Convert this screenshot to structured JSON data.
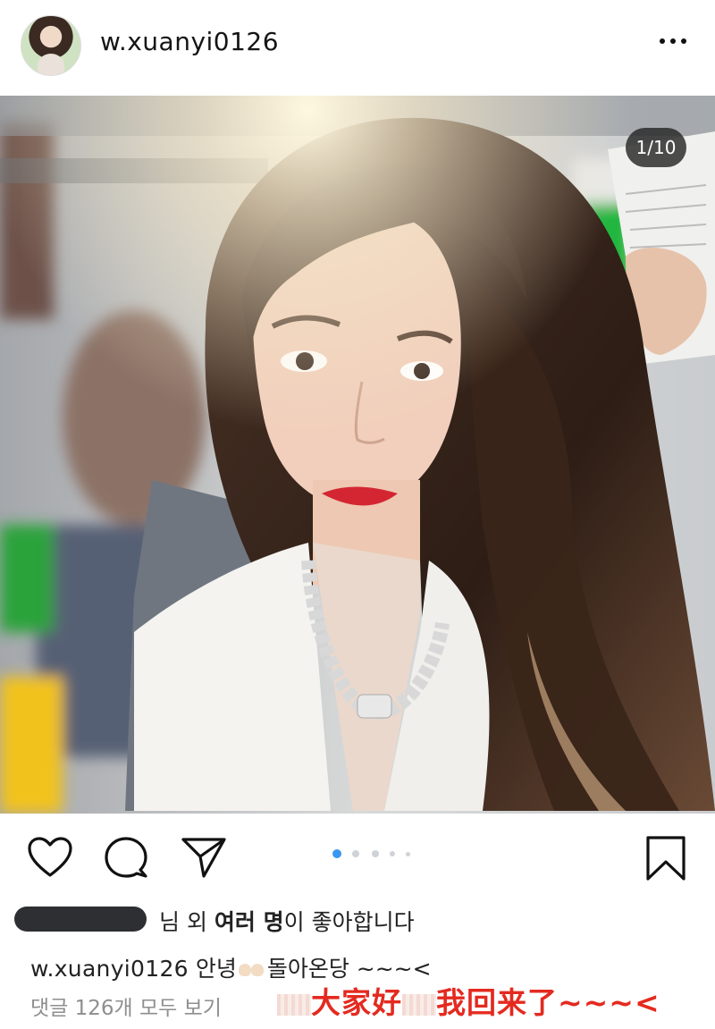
{
  "header": {
    "username": "w.xuanyi0126",
    "avatar_icon": "profile-avatar",
    "more_icon": "more-horizontal-icon"
  },
  "photo": {
    "counter": "1/10"
  },
  "actions": {
    "like_icon": "heart-icon",
    "comment_icon": "comment-bubble-icon",
    "share_icon": "paper-plane-icon",
    "save_icon": "bookmark-icon",
    "carousel_total": 5,
    "carousel_active_index": 0
  },
  "likes": {
    "part1": "님 외 ",
    "bold": "여러 명",
    "part2": "이 좋아합니다"
  },
  "caption": {
    "username": "w.xuanyi0126",
    "text_before": "안녕",
    "text_after": "돌아온당 ~~~<"
  },
  "comments": {
    "view_all": "댓글 126개 모두 보기"
  },
  "overlay_caption": {
    "part1": "大家好",
    "part2": "我回来了~~~<"
  },
  "colors": {
    "accent_blue": "#3897f0",
    "overlay_red": "#e42a1f"
  }
}
